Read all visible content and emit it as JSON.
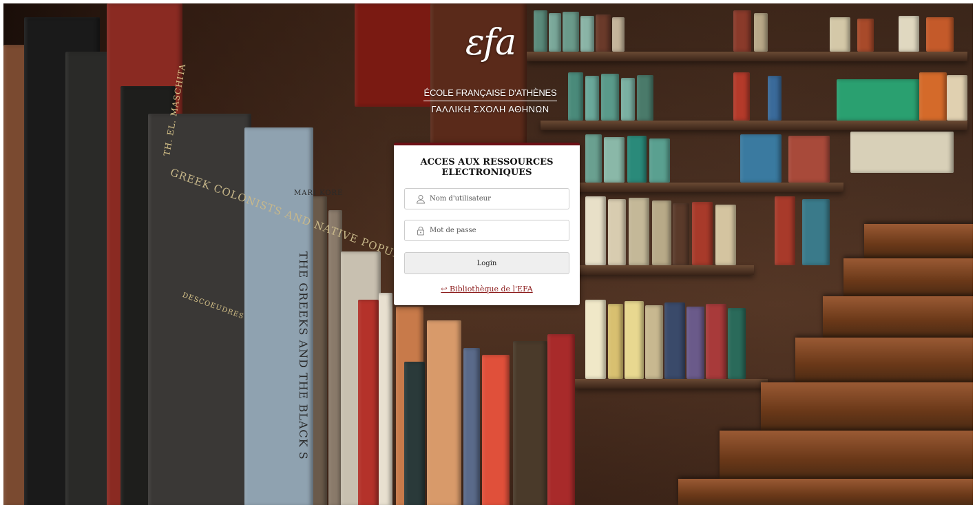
{
  "logo": {
    "mark": "εfa",
    "name_fr": "ÉCOLE FRANÇAISE D'ATHÈNES",
    "name_gr": "ΓΑΛΛΙΚΗ ΣΧΟΛΗ ΑΘΗΝΩΝ"
  },
  "background": {
    "spine_texts": [
      "GREEK COLONISTS AND NATIVE POPULATIONS",
      "DESCOEUDRES",
      "THE GREEKS AND THE BLACK S",
      "TH. EL. MASCHITA",
      "MARI KORE"
    ]
  },
  "login": {
    "title_line1": "ACCES AUX RESSOURCES",
    "title_line2": "ELECTRONIQUES",
    "username": {
      "placeholder": "Nom d'utilisateur",
      "value": "",
      "icon": "user-icon"
    },
    "password": {
      "placeholder": "Mot de passe",
      "value": "",
      "icon": "lock-icon"
    },
    "submit_label": "Login",
    "back_link": "↩ Bibliothèque de l'EFA"
  },
  "colors": {
    "accent": "#6b0f15",
    "link": "#8b1a1a",
    "button_bg": "#efefef"
  }
}
